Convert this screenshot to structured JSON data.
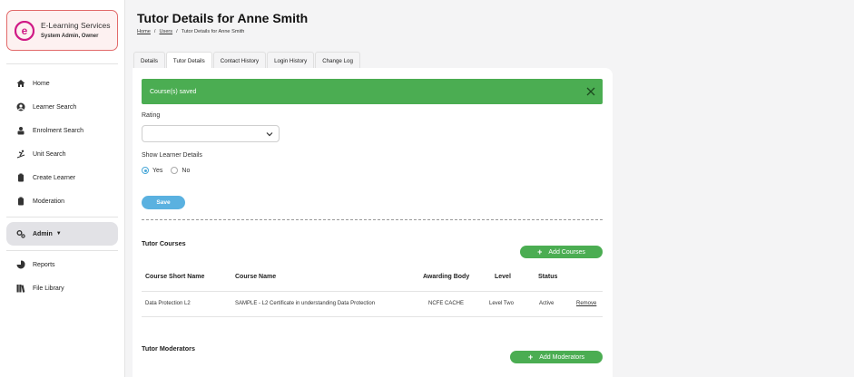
{
  "org": {
    "name": "E-Learning Services",
    "role": "System Admin, Owner",
    "logo_letter": "e",
    "brand_color": "#d01a86"
  },
  "sidebar": {
    "items": [
      {
        "label": "Home",
        "icon": "home-icon"
      },
      {
        "label": "Learner Search",
        "icon": "user-circle-icon"
      },
      {
        "label": "Enrolment Search",
        "icon": "user-badge-icon"
      },
      {
        "label": "Unit Search",
        "icon": "ski-icon"
      },
      {
        "label": "Create Learner",
        "icon": "clipboard-icon"
      },
      {
        "label": "Moderation",
        "icon": "clipboard-check-icon"
      },
      {
        "label": "Admin",
        "icon": "gears-icon",
        "active": true
      },
      {
        "label": "Reports",
        "icon": "pie-chart-icon"
      },
      {
        "label": "File Library",
        "icon": "books-icon"
      }
    ]
  },
  "page": {
    "title": "Tutor Details for Anne Smith",
    "breadcrumb": [
      "Home",
      "Users",
      "Tutor Details for Anne Smith"
    ]
  },
  "tabs": [
    "Details",
    "Tutor Details",
    "Contact History",
    "Login History",
    "Change Log"
  ],
  "active_tab": "Tutor Details",
  "alert": {
    "text": "Course(s) saved",
    "color": "#4bad52"
  },
  "form": {
    "rating_label": "Rating",
    "rating_value": "",
    "show_learner_label": "Show Learner Details",
    "yes_label": "Yes",
    "no_label": "No",
    "selected": "Yes",
    "save_label": "Save"
  },
  "courses": {
    "title": "Tutor Courses",
    "add_label": "Add Courses",
    "columns": [
      "Course Short Name",
      "Course Name",
      "Awarding Body",
      "Level",
      "Status"
    ],
    "rows": [
      {
        "short_name": "Data Protection L2",
        "name": "SAMPLE - L2 Certificate in understanding Data Protection",
        "body": "NCFE CACHE",
        "level": "Level Two",
        "status": "Active",
        "action": "Remove"
      }
    ]
  },
  "moderators": {
    "title": "Tutor Moderators",
    "add_label": "Add Moderators"
  }
}
